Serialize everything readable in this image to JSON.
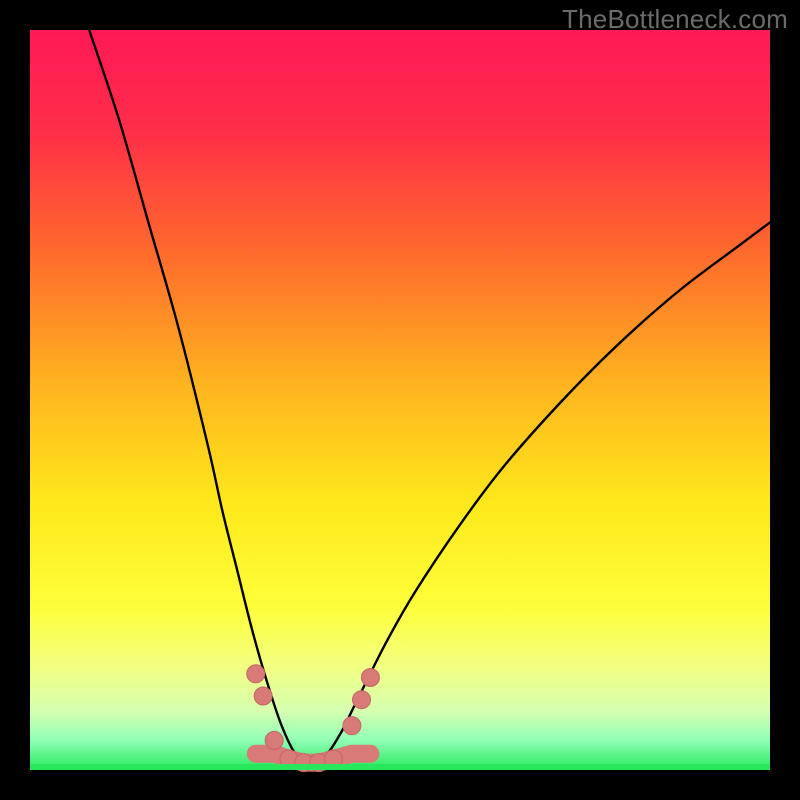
{
  "watermark": {
    "text": "TheBottleneck.com"
  },
  "colors": {
    "frame": "#000000",
    "curve": "#000000",
    "markers_fill": "#d77a78",
    "markers_stroke": "#c46663",
    "green_band": "#27e85c"
  },
  "chart_data": {
    "type": "line",
    "title": "",
    "xlabel": "",
    "ylabel": "",
    "xlim": [
      0,
      100
    ],
    "ylim": [
      0,
      100
    ],
    "grid": false,
    "legend": false,
    "note": "Bottleneck-style V-curve; x is relative component balance, y is mismatch/bottleneck percentage. Minimum (optimal) sits near x≈36. Values estimated from pixel positions.",
    "series": [
      {
        "name": "bottleneck-curve",
        "x": [
          8,
          12,
          16,
          20,
          24,
          26,
          28,
          30,
          32,
          34,
          36,
          38,
          40,
          42,
          44,
          48,
          52,
          58,
          64,
          72,
          80,
          88,
          96,
          100
        ],
        "y": [
          100,
          88,
          74,
          60,
          44,
          35,
          27,
          19,
          12,
          6,
          2,
          1,
          2,
          5,
          9,
          17,
          24,
          33,
          41,
          50,
          58,
          65,
          71,
          74
        ]
      }
    ],
    "markers": {
      "name": "highlighted-points",
      "note": "Salmon rounded markers clustered around the valley floor",
      "x": [
        30.5,
        31.5,
        33,
        35,
        37,
        39,
        41,
        43.5,
        44.8,
        46
      ],
      "y": [
        13,
        10,
        4,
        1.5,
        1,
        1,
        1.5,
        6,
        9.5,
        12.5
      ]
    },
    "gradient_stops": [
      {
        "pct": 0,
        "color": "#ff1956"
      },
      {
        "pct": 14,
        "color": "#ff2f48"
      },
      {
        "pct": 30,
        "color": "#ff6a2d"
      },
      {
        "pct": 48,
        "color": "#ffb41f"
      },
      {
        "pct": 64,
        "color": "#ffe81b"
      },
      {
        "pct": 78,
        "color": "#fdff3a"
      },
      {
        "pct": 86,
        "color": "#f2ff82"
      },
      {
        "pct": 92,
        "color": "#d6ffb0"
      },
      {
        "pct": 96,
        "color": "#8fffb6"
      },
      {
        "pct": 100,
        "color": "#27e85c"
      }
    ]
  }
}
